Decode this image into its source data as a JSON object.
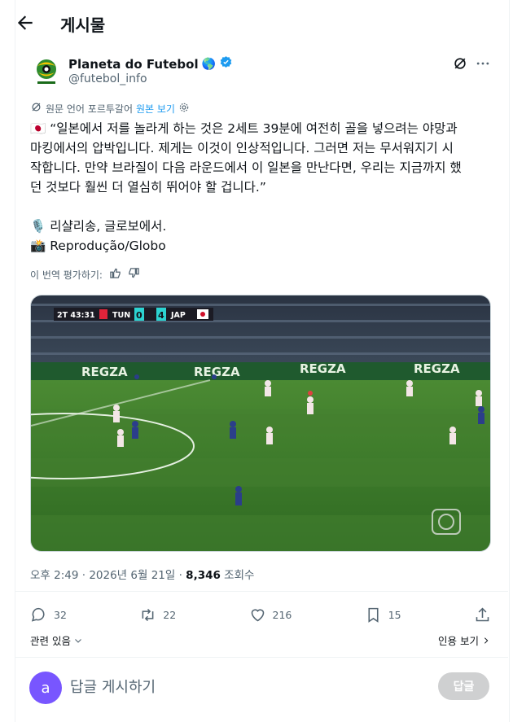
{
  "header": {
    "title": "게시물"
  },
  "author": {
    "name": "Planeta do Futebol",
    "globe": "🌎",
    "handle": "@futebol_info"
  },
  "translation": {
    "label": "원문 언어 포르투갈어",
    "link": "원본 보기"
  },
  "tweet": {
    "text": "🇯🇵 “일본에서 저를 놀라게 하는 것은 2세트 39분에 여전히 골을 넣으려는 야망과\n마킹에서의 압박입니다. 제게는 이것이 인상적입니다. 그러면 저는 무서워지기 시\n작합니다. 만약 브라질이 다음 라운드에서 이 일본을 만난다면, 우리는 지금까지 했\n던 것보다 훨씬 더 열심히 뛰어야 할 겁니다.”\n\n🎙️ 리샬리송, 글로보에서.\n📸 Reprodução/Globo"
  },
  "rate": {
    "label": "이 번역 평가하기:"
  },
  "media": {
    "scoreboard": {
      "period": "2T 43:31",
      "home": "TUN",
      "home_score": "0",
      "away_score": "4",
      "away": "JAP"
    },
    "ad_text": "REGZA"
  },
  "meta": {
    "time": "오후 2:49 · 2026년 6월 21일 · ",
    "views": "8,346",
    "views_label": " 조회수"
  },
  "actions": {
    "replies": "32",
    "reposts": "22",
    "likes": "216",
    "bookmarks": "15"
  },
  "related": "관련 있음",
  "quotes": "인용 보기",
  "reply": {
    "avatar_letter": "a",
    "placeholder": "답글 게시하기",
    "button": "답글"
  },
  "colors": {
    "accent": "#1d9bf0",
    "verified": "#1d9bf0",
    "pitch": "#3f7a2c"
  }
}
